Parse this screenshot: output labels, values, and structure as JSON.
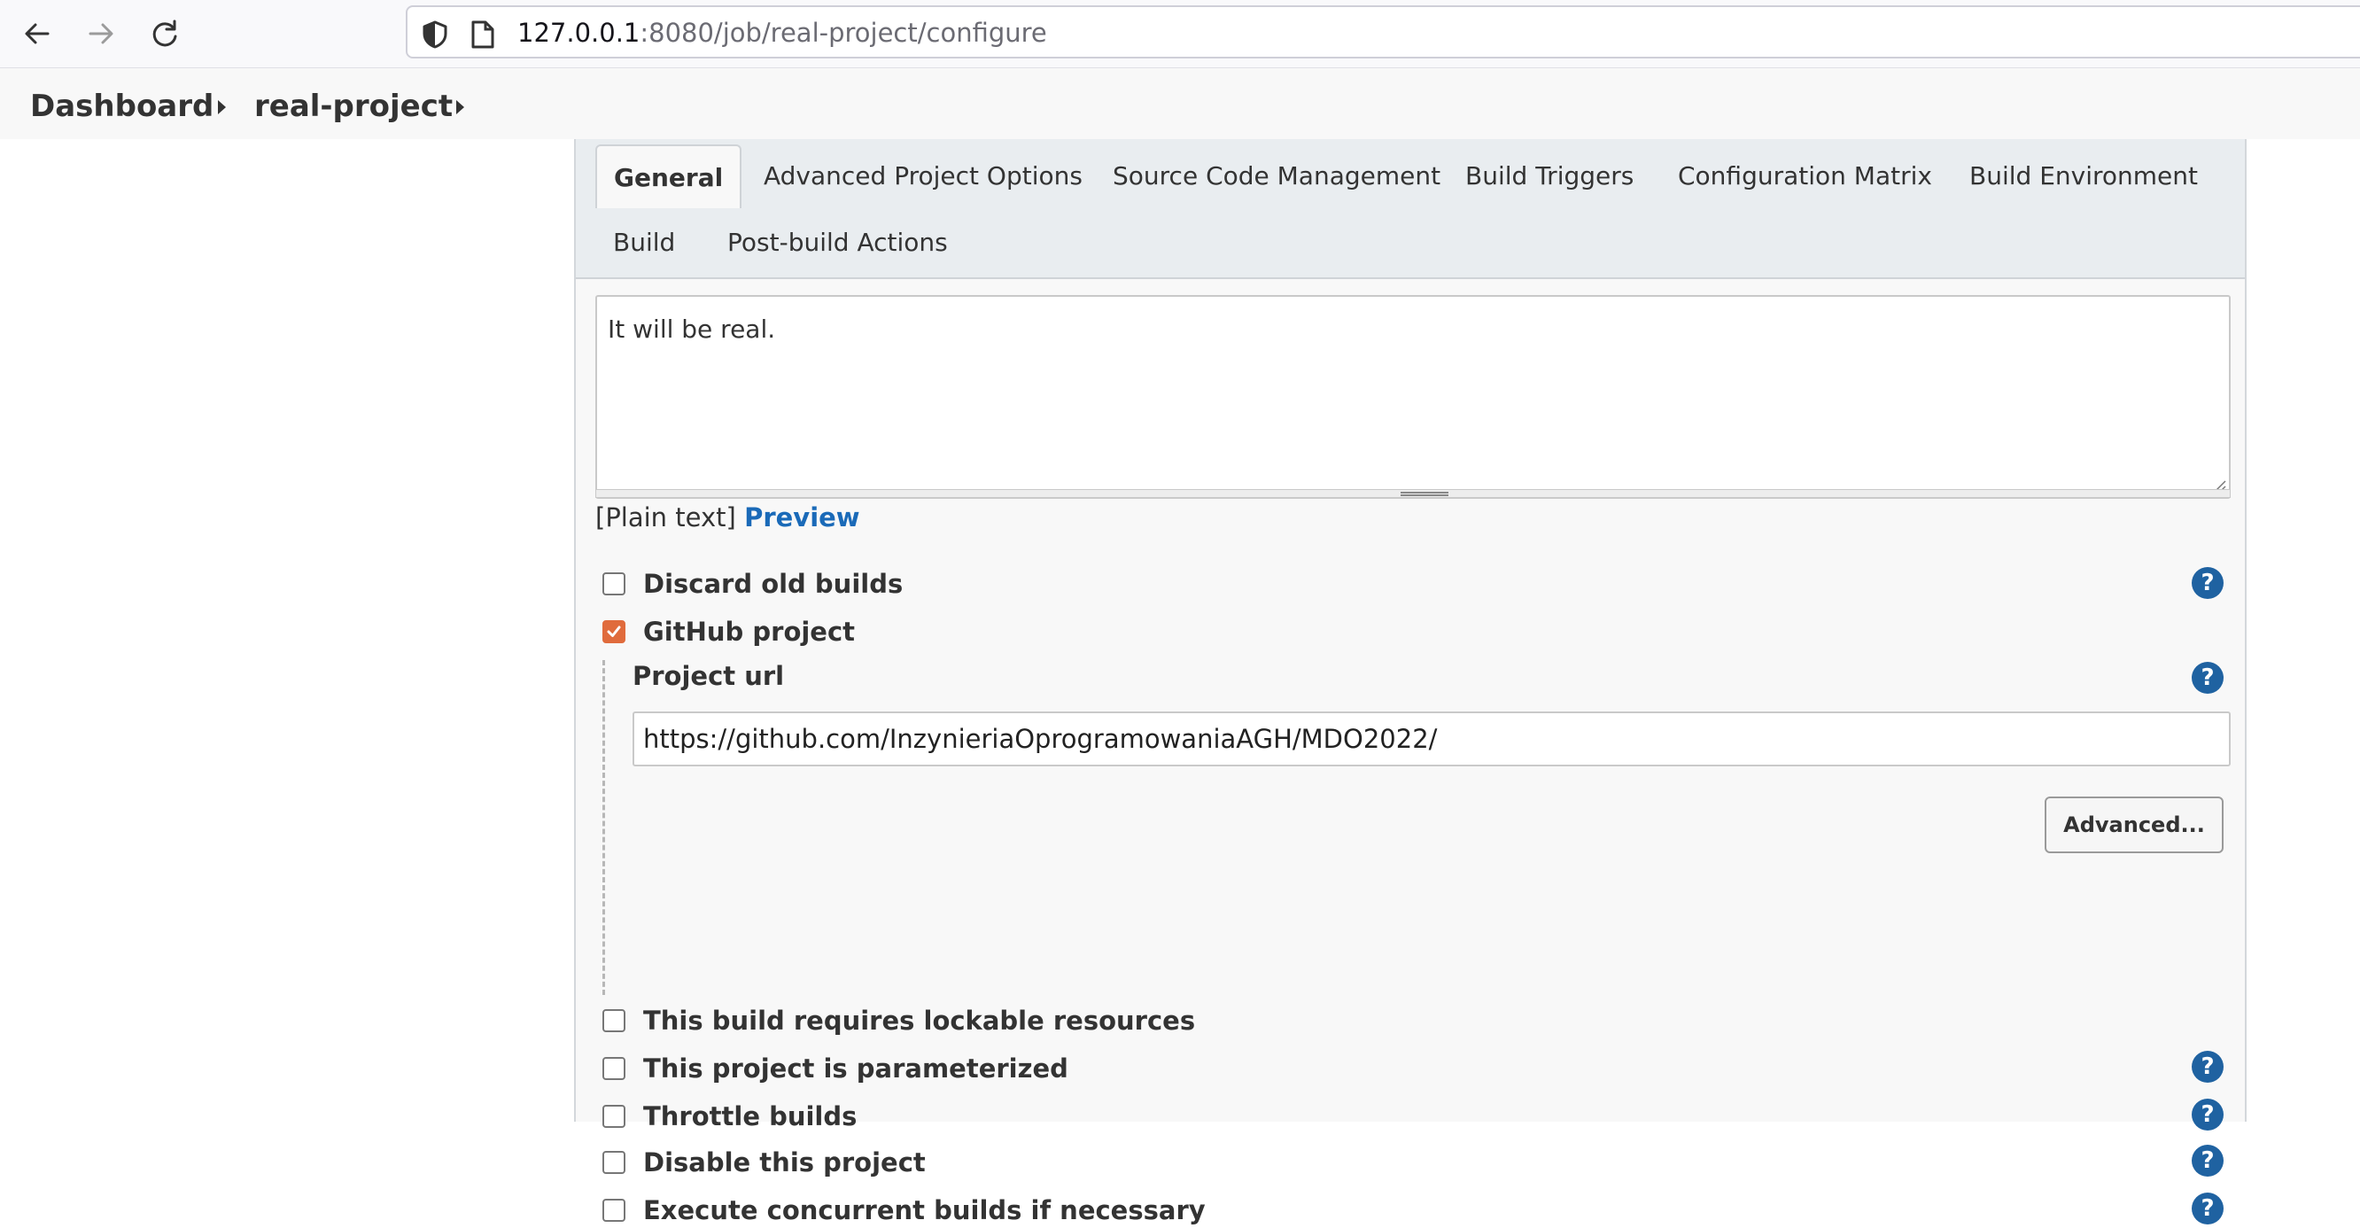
{
  "browser": {
    "url_host": "127.0.0.1",
    "url_rest": ":8080/job/real-project/configure"
  },
  "breadcrumb": {
    "items": [
      "Dashboard",
      "real-project"
    ]
  },
  "tabs": [
    "General",
    "Advanced Project Options",
    "Source Code Management",
    "Build Triggers",
    "Configuration Matrix",
    "Build Environment",
    "Build",
    "Post-build Actions"
  ],
  "description": {
    "value": "It will be real.",
    "format_prefix": "[Plain text]",
    "preview_label": "Preview"
  },
  "options": [
    {
      "label": "Discard old builds",
      "checked": false
    },
    {
      "label": "GitHub project",
      "checked": true
    },
    {
      "label": "This build requires lockable resources",
      "checked": false
    },
    {
      "label": "This project is parameterized",
      "checked": false
    },
    {
      "label": "Throttle builds",
      "checked": false
    },
    {
      "label": "Disable this project",
      "checked": false
    },
    {
      "label": "Execute concurrent builds if necessary",
      "checked": false
    }
  ],
  "github": {
    "project_url_label": "Project url",
    "project_url_value": "https://github.com/InzynieriaOprogramowaniaAGH/MDO2022/",
    "advanced_label": "Advanced..."
  },
  "help_label": "?",
  "colors": {
    "accent_checkbox": "#e06b3c",
    "help_icon": "#1f62a1",
    "link": "#1a6ab8"
  }
}
